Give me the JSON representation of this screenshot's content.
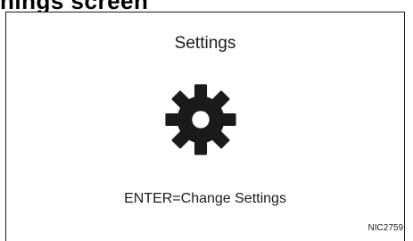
{
  "top_heading_fragment": "nings screen",
  "screen": {
    "title": "Settings",
    "icon": "gear-icon",
    "prompt": "ENTER=Change Settings"
  },
  "figure_code": "NIC2759"
}
